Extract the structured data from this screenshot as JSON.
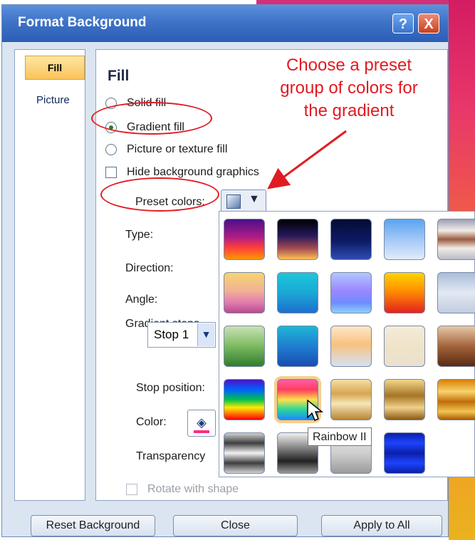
{
  "window": {
    "title": "Format Background",
    "help_icon": "?",
    "close_icon": "X"
  },
  "sidebar": {
    "items": [
      {
        "label": "Fill",
        "selected": true
      },
      {
        "label": "Picture",
        "selected": false
      }
    ]
  },
  "main": {
    "heading": "Fill",
    "options": {
      "solid_fill": "Solid fill",
      "gradient_fill": "Gradient fill",
      "picture_fill": "Picture or texture fill",
      "hide_background": "Hide background graphics"
    },
    "labels": {
      "preset_colors": "Preset colors:",
      "type": "Type:",
      "direction": "Direction:",
      "angle": "Angle:",
      "gradient_stops": "Gradient stops",
      "stop_position": "Stop position:",
      "color": "Color:",
      "transparency": "Transparency",
      "rotate_with_shape": "Rotate with shape"
    },
    "gradient_stop_value": "Stop 1"
  },
  "annotation": {
    "line1": "Choose a preset",
    "line2": "group of colors for",
    "line3": "the gradient"
  },
  "preset_palette": {
    "tooltip": "Rainbow II",
    "selected_index": 16,
    "swatches": [
      {
        "gradient": "linear-gradient(180deg,#4b0f8b 0%,#b01d86 45%,#ff3c3c 70%,#ff9700 100%)"
      },
      {
        "gradient": "linear-gradient(180deg,#000000 0%,#23185a 40%,#a14a52 72%,#ffc054 100%)"
      },
      {
        "gradient": "linear-gradient(180deg,#050b33 0%,#0d1b66 55%,#2f4cb3 100%)"
      },
      {
        "gradient": "linear-gradient(180deg,#5aa4ef 0%,#9cc4f6 45%,#e1ecfb 100%)"
      },
      {
        "gradient": "linear-gradient(180deg,#9a9fb6 0%,#f2ece6 28%,#9a5a41 50%,#f2ece6 72%,#b8bcc8 100%)"
      },
      {
        "gradient": "linear-gradient(180deg,#f8d56e 0%,#f1b295 45%,#e07bb0 75%,#b74a8a 100%)"
      },
      {
        "gradient": "linear-gradient(180deg,#1cc6d8 0%,#1ba8d4 50%,#1d6fd0 100%)"
      },
      {
        "gradient": "linear-gradient(180deg,#b0c8ff 0%,#9b86ff 45%,#6d8dff 75%,#8fd0ff 100%)"
      },
      {
        "gradient": "linear-gradient(180deg,#ffd400 0%,#ff8f00 45%,#e4221f 100%)"
      },
      {
        "gradient": "linear-gradient(180deg,#a9bcd9 0%,#e3e9f3 50%,#c1cde1 100%)"
      },
      {
        "gradient": "linear-gradient(180deg,#c9e1b6 0%,#84bf68 45%,#2f7d2d 100%)"
      },
      {
        "gradient": "linear-gradient(180deg,#1fb6d5 0%,#1f7ed0 50%,#174db1 100%)"
      },
      {
        "gradient": "linear-gradient(180deg,#fde8c8 0%,#f7c27f 45%,#d6e0f4 100%)"
      },
      {
        "gradient": "linear-gradient(180deg,#f4ecda 0%,#efe3c8 50%,#ebe0ce 100%)"
      },
      {
        "gradient": "linear-gradient(180deg,#e6c8a8 0%,#a2643b 50%,#5a2a14 100%)"
      },
      {
        "gradient": "linear-gradient(180deg,#4d12c6 0%,#0061ff 25%,#00c24a 50%,#ffea00 70%,#ff0000 100%)"
      },
      {
        "gradient": "linear-gradient(180deg,#ff5ea8 0%,#ff3d5e 25%,#ffe04a 50%,#28d69b 75%,#1f87ff 100%)"
      },
      {
        "gradient": "linear-gradient(180deg,#f4dfa6 0%,#d6a64f 35%,#f5e6b7 60%,#b88433 100%)"
      },
      {
        "gradient": "linear-gradient(180deg,#f2d78c 0%,#a67524 40%,#f0d08a 70%,#8a5a16 100%)"
      },
      {
        "gradient": "linear-gradient(180deg,#d97e08 0%,#f9d26c 30%,#c06e0a 55%,#f2c552 80%,#a95908 100%)"
      },
      {
        "gradient": "linear-gradient(180deg,#d1d1d1 0%,#3e3e3e 25%,#f2f2f2 50%,#3e3e3e 75%,#d1d1d1 100%)"
      },
      {
        "gradient": "linear-gradient(180deg,#f1f1f1 0%,#7b7b7b 40%,#222222 70%,#9a9a9a 100%)"
      },
      {
        "gradient": "linear-gradient(180deg,#e7e7e7 0%,#cfcfcf 50%,#9b9b9b 100%)"
      },
      {
        "gradient": "linear-gradient(180deg,#0b20a8 0%,#1d43ff 25%,#0b20a8 50%,#1d43ff 75%,#0b20a8 100%)"
      }
    ]
  },
  "footer": {
    "reset": "Reset Background",
    "close": "Close",
    "apply": "Apply to All"
  },
  "colors": {
    "accent": "#e11b22",
    "titlebar": "#3f73c7"
  }
}
